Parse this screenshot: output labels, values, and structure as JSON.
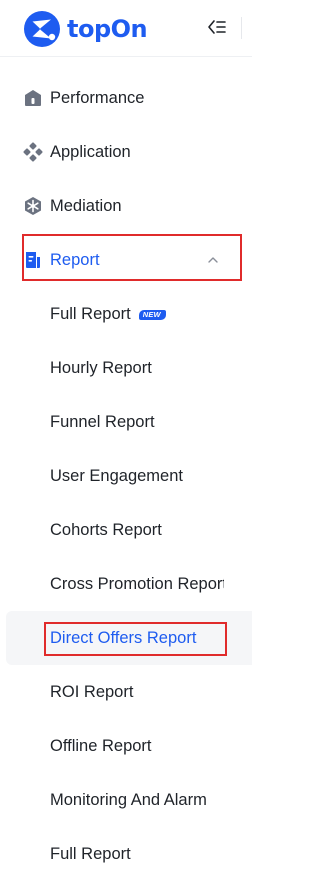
{
  "brand": {
    "name": "topOn",
    "accent_color": "#1e5cf0"
  },
  "header": {
    "collapse_icon": "menu-fold-icon"
  },
  "menu": [
    {
      "label": "Performance",
      "icon": "dashboard-icon"
    },
    {
      "label": "Application",
      "icon": "application-icon"
    },
    {
      "label": "Mediation",
      "icon": "mediation-icon"
    },
    {
      "label": "Report",
      "icon": "report-icon",
      "expanded": true,
      "active": true
    }
  ],
  "report_submenu": [
    {
      "label": "Full Report",
      "badge": "NEW"
    },
    {
      "label": "Hourly Report"
    },
    {
      "label": "Funnel Report"
    },
    {
      "label": "User Engagement"
    },
    {
      "label": "Cohorts Report"
    },
    {
      "label": "Cross Promotion Report"
    },
    {
      "label": "Direct Offers Report",
      "selected": true
    },
    {
      "label": "ROI Report"
    },
    {
      "label": "Offline Report"
    },
    {
      "label": "Monitoring And Alarm"
    },
    {
      "label": "Full Report"
    }
  ],
  "highlights": [
    {
      "target": "Report",
      "color": "#e02b2b"
    },
    {
      "target": "Direct Offers Report",
      "color": "#e02b2b"
    }
  ]
}
